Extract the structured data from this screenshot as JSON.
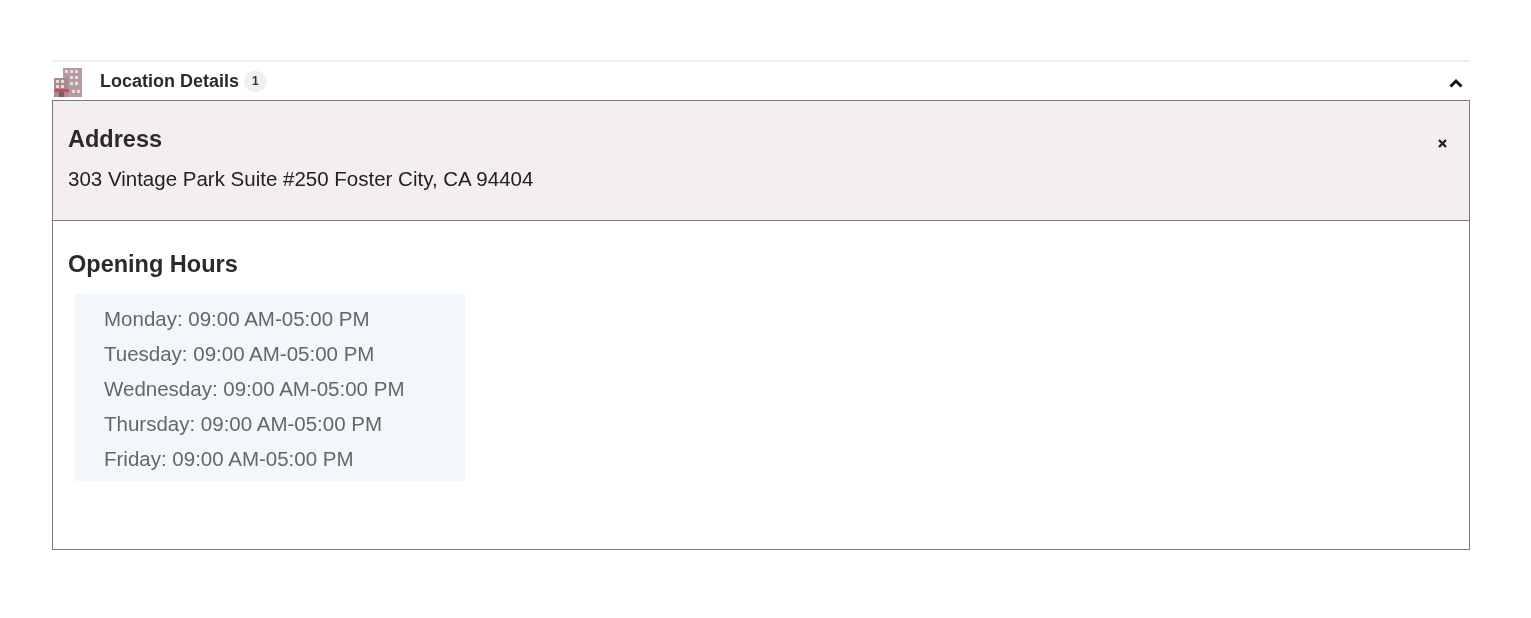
{
  "section": {
    "title": "Location Details",
    "count": "1",
    "expanded": true
  },
  "address": {
    "heading": "Address",
    "text": "303 Vintage Park Suite #250 Foster City, CA 94404"
  },
  "opening_hours": {
    "heading": "Opening Hours",
    "days": [
      "Monday: 09:00 AM-05:00 PM",
      "Tuesday: 09:00 AM-05:00 PM",
      "Wednesday: 09:00 AM-05:00 PM",
      "Thursday: 09:00 AM-05:00 PM",
      "Friday: 09:00 AM-05:00 PM"
    ]
  }
}
